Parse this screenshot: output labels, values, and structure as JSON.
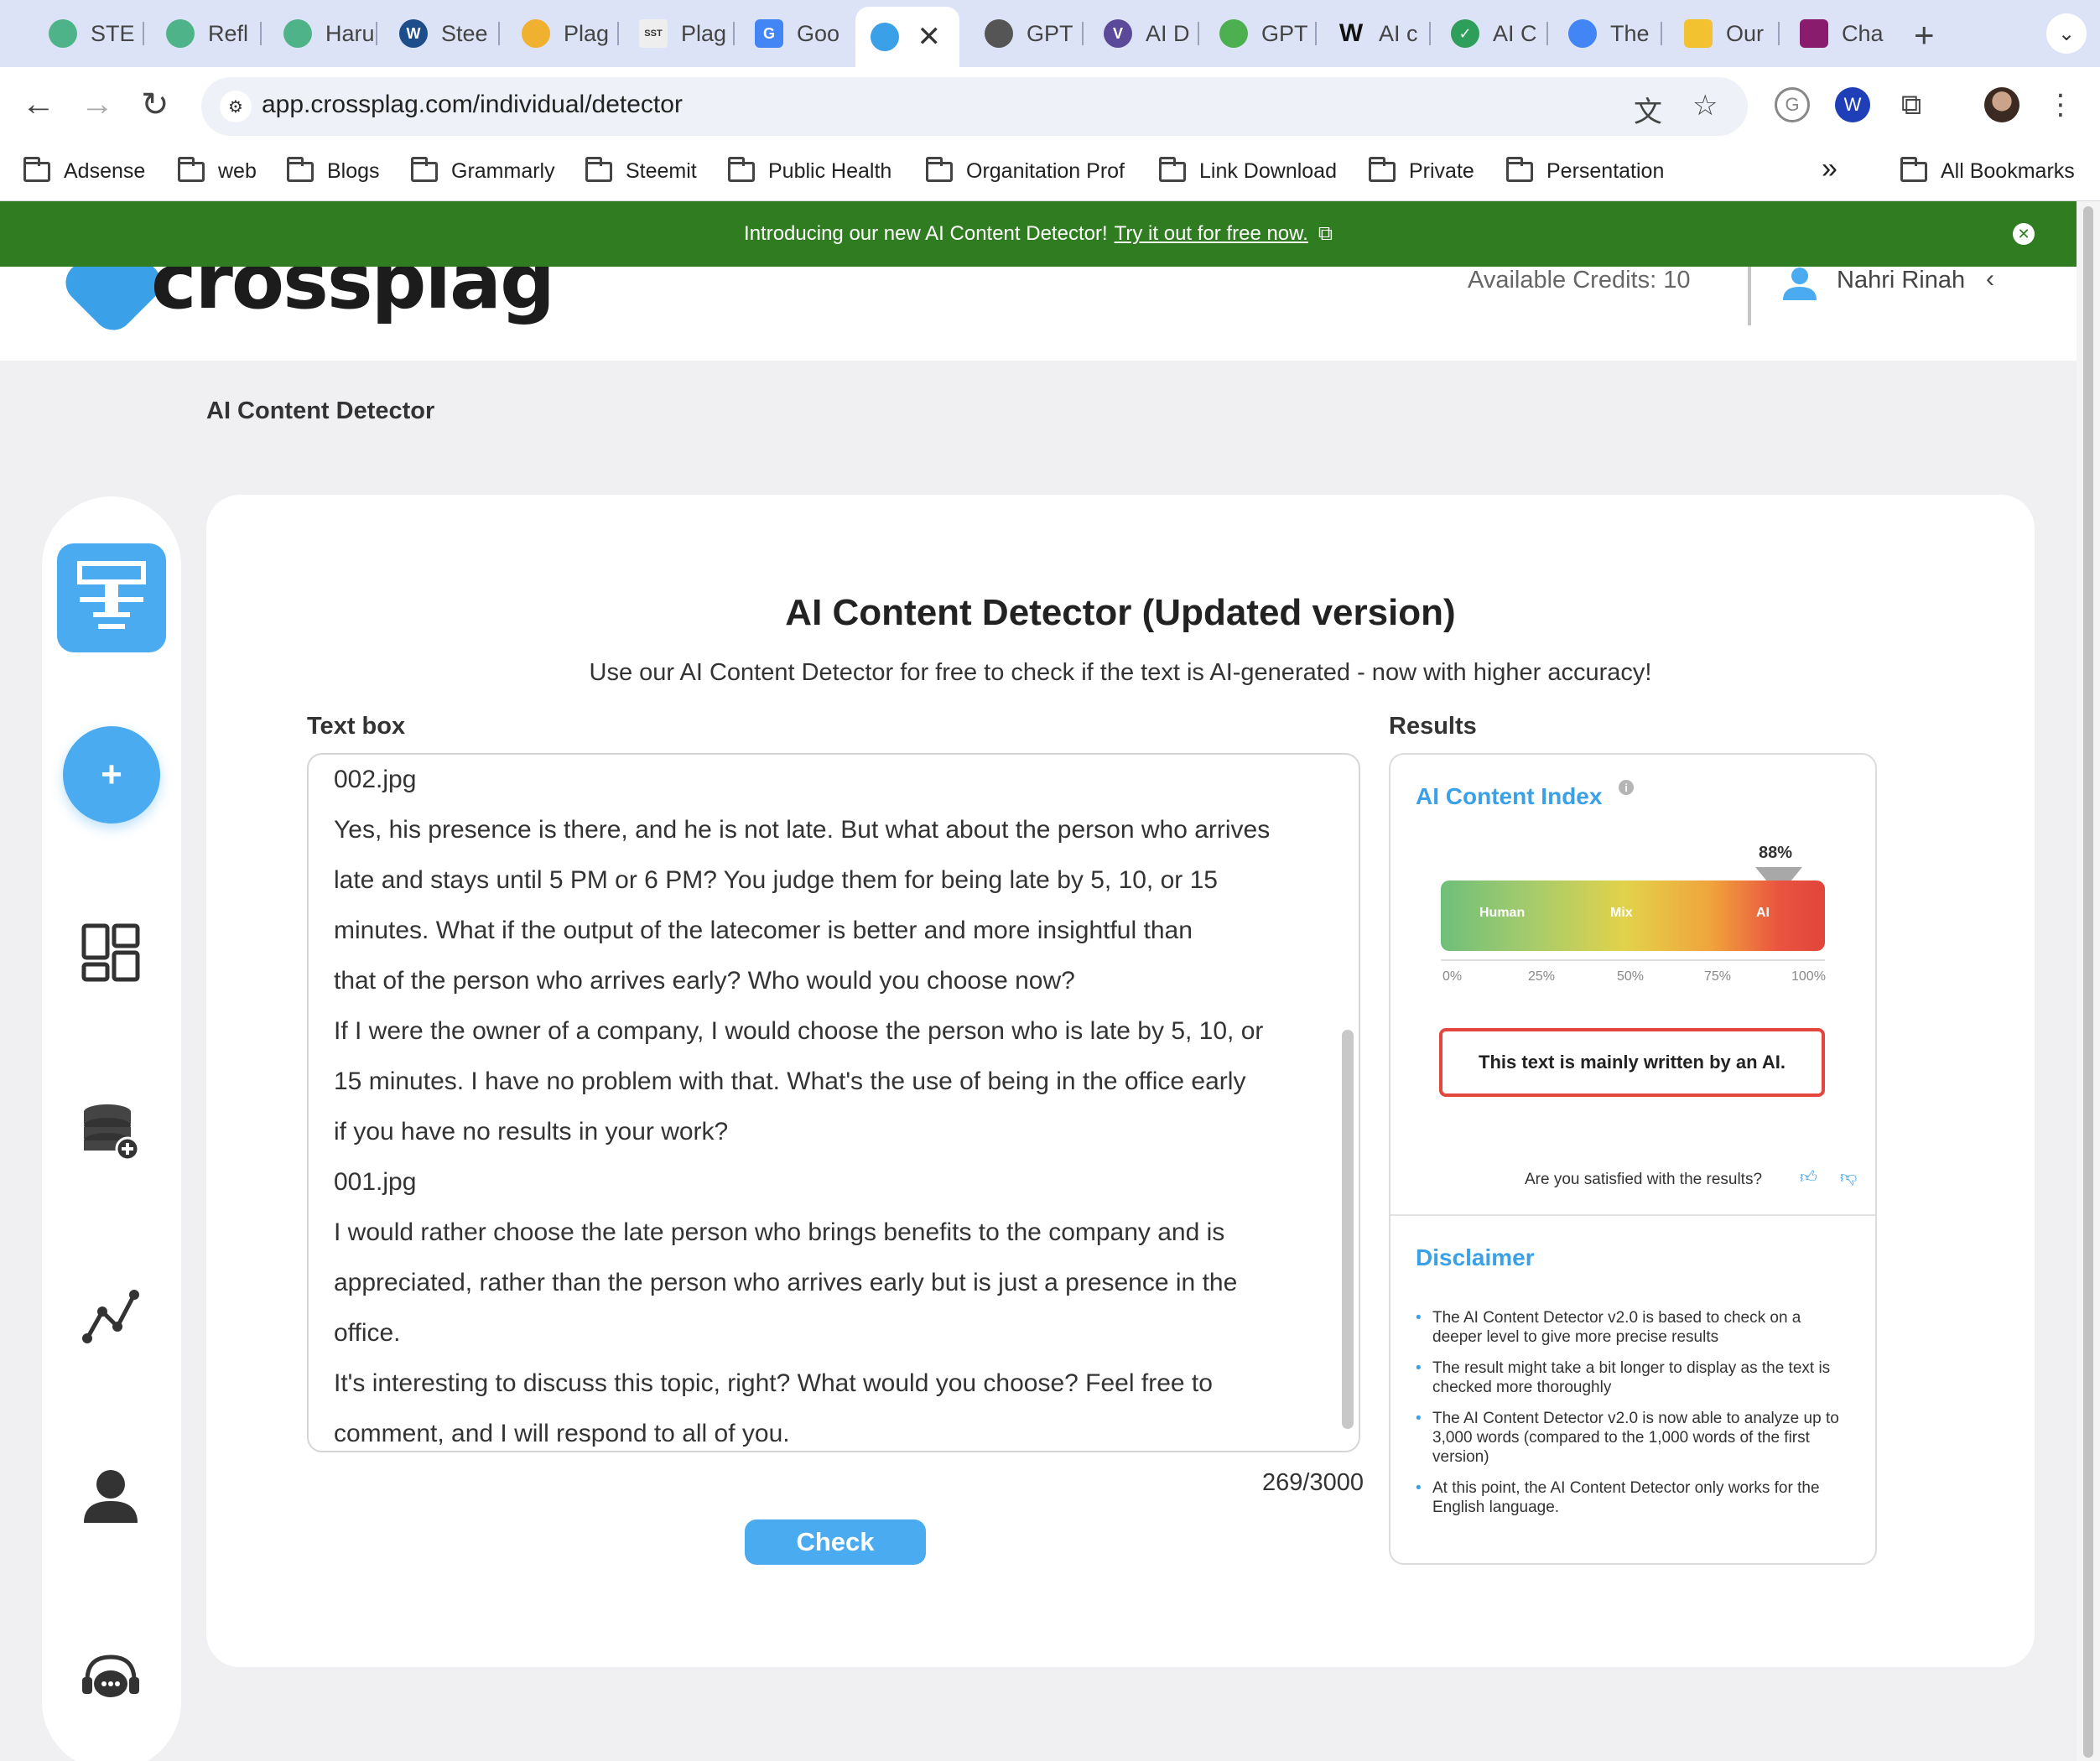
{
  "browser": {
    "tabs": [
      {
        "label": "STE",
        "icon_color": "#4fb38a"
      },
      {
        "label": "Refl",
        "icon_color": "#4fb38a"
      },
      {
        "label": "Haru",
        "icon_color": "#4fb38a"
      },
      {
        "label": "Stee",
        "icon_color": "#1e4d8c"
      },
      {
        "label": "Plag",
        "icon_color": "#f0b030"
      },
      {
        "label": "Plag",
        "icon_color": "#666666"
      },
      {
        "label": "Goo",
        "icon_color": "#4285f4"
      },
      {
        "label": "",
        "icon_color": "#3aa0e8",
        "active": true
      },
      {
        "label": "GPT",
        "icon_color": "#555555"
      },
      {
        "label": "AI D",
        "icon_color": "#5b4a9a"
      },
      {
        "label": "GPT",
        "icon_color": "#4caf50"
      },
      {
        "label": "AI c",
        "icon_color": "#111111"
      },
      {
        "label": "AI C",
        "icon_color": "#2e9e5b"
      },
      {
        "label": "The",
        "icon_color": "#4285f4"
      },
      {
        "label": "Our",
        "icon_color": "#f2c230"
      },
      {
        "label": "Cha",
        "icon_color": "#8a1c6e"
      }
    ],
    "url": "app.crossplag.com/individual/detector",
    "bookmarks": [
      "Adsense",
      "web",
      "Blogs",
      "Grammarly",
      "Steemit",
      "Public Health",
      "Organitation Prof",
      "Link Download",
      "Private",
      "Persentation"
    ],
    "all_bookmarks": "All Bookmarks",
    "overflow": "»"
  },
  "banner": {
    "text": "Introducing our new AI Content Detector!",
    "link": "Try it out for free now."
  },
  "header": {
    "logo_text": "crossplag",
    "credits": "Available Credits: 10",
    "user_name": "Nahri Rinah"
  },
  "page": {
    "title": "AI Content Detector",
    "heading": "AI Content Detector (Updated version)",
    "subheading": "Use our AI Content Detector for free to check if the text is AI-generated - now with higher accuracy!",
    "textbox_label": "Text box",
    "results_label": "Results",
    "textbox_lines": [
      "002.jpg",
      "Yes, his presence is there, and he is not late. But what about the person who arrives",
      "late and stays until 5 PM or 6 PM? You judge them for being late by 5, 10, or 15",
      "minutes. What if the output of the latecomer is better and more insightful than",
      "that of the person who arrives early? Who would you choose now?",
      "If I were the owner of a company, I would choose the person who is late by 5, 10, or",
      "15 minutes. I have no problem with that. What's the use of being in the office early",
      "if you have no results in your work?",
      "001.jpg",
      "I would rather choose the late person who brings benefits to the company and is",
      "appreciated, rather than the person who arrives early but is just a presence in the",
      "office.",
      "It's interesting to discuss this topic, right? What would you choose? Feel free to",
      "comment, and I will respond to all of you."
    ],
    "word_count": "269/3000",
    "check_label": "Check"
  },
  "results": {
    "index_title": "AI Content Index",
    "score_label": "88%",
    "score_value": 0.88,
    "segments": [
      "Human",
      "Mix",
      "AI"
    ],
    "ticks": [
      "0%",
      "25%",
      "50%",
      "75%",
      "100%"
    ],
    "verdict": "This text is mainly written by an AI.",
    "satisfied": "Are you satisfied with the results?",
    "disclaimer_title": "Disclaimer",
    "disclaimer_items": [
      "The AI Content Detector v2.0 is based to check on a deeper level to give more precise results",
      "The result might take a bit longer to display as the text is checked more thoroughly",
      "The AI Content Detector v2.0 is now able to analyze up to 3,000 words (compared to the 1,000 words of the first version)",
      "At this point, the AI Content Detector only works for the English language."
    ]
  },
  "colors": {
    "accent": "#4aabf0",
    "banner_green": "#2f7d20",
    "verdict_red": "#e2463c"
  }
}
